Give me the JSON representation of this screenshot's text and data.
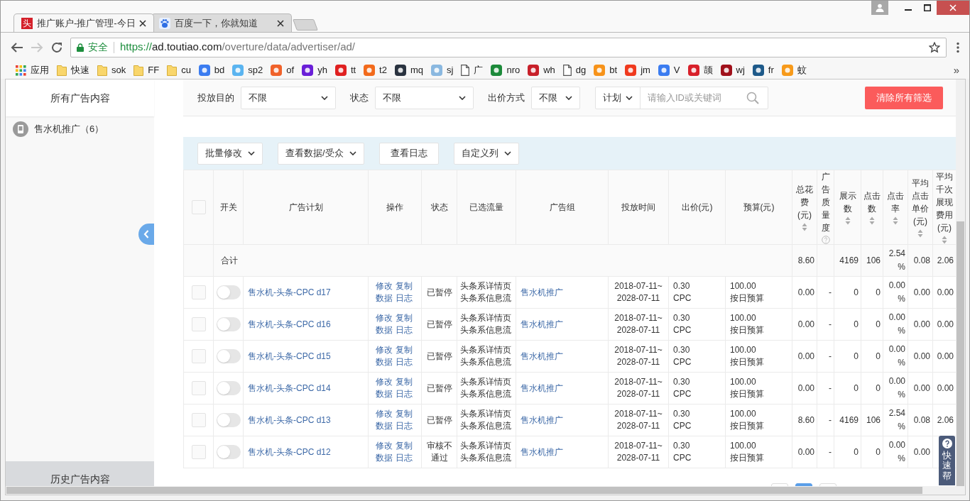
{
  "browser": {
    "tabs": [
      {
        "title": "推广账户-推广管理-今日",
        "selected": true,
        "favicon": {
          "kind": "letter",
          "text": "头"
        }
      },
      {
        "title": "百度一下，你就知道",
        "selected": false,
        "favicon": {
          "kind": "paw"
        }
      }
    ],
    "address": {
      "security": "安全",
      "scheme": "https://",
      "host": "ad.toutiao.com",
      "path": "/overture/data/advertiser/ad/"
    },
    "forward_disabled": true,
    "bookmarks": [
      {
        "label": "应用",
        "kind": "apps"
      },
      {
        "label": "快速",
        "kind": "folder"
      },
      {
        "label": "sok",
        "kind": "folder"
      },
      {
        "label": "FF",
        "kind": "folder"
      },
      {
        "label": "cu",
        "kind": "folder"
      },
      {
        "label": "bd",
        "kind": "site",
        "color": "#3b7cf0"
      },
      {
        "label": "sp2",
        "kind": "site",
        "color": "#5ab4f0"
      },
      {
        "label": "of",
        "kind": "site",
        "color": "#f0622a"
      },
      {
        "label": "yh",
        "kind": "site",
        "color": "#6a1fd8"
      },
      {
        "label": "tt",
        "kind": "site",
        "color": "#e02020"
      },
      {
        "label": "t2",
        "kind": "site",
        "color": "#f26a1b"
      },
      {
        "label": "mq",
        "kind": "site",
        "color": "#2a3340"
      },
      {
        "label": "sj",
        "kind": "site",
        "color": "#8ab8e0"
      },
      {
        "label": "广",
        "kind": "page"
      },
      {
        "label": "nro",
        "kind": "site",
        "color": "#1c8a3a"
      },
      {
        "label": "wh",
        "kind": "site",
        "color": "#c8202a"
      },
      {
        "label": "dg",
        "kind": "page"
      },
      {
        "label": "bt",
        "kind": "site",
        "color": "#f7931a"
      },
      {
        "label": "jm",
        "kind": "site",
        "color": "#f03a1e"
      },
      {
        "label": "V",
        "kind": "site",
        "color": "#3b7cf0"
      },
      {
        "label": "颉",
        "kind": "site",
        "color": "#d8202a"
      },
      {
        "label": "wj",
        "kind": "site",
        "color": "#a0101a"
      },
      {
        "label": "fr",
        "kind": "site",
        "color": "#1e5a8a"
      },
      {
        "label": "蚊",
        "kind": "site",
        "color": "#f79a1a"
      }
    ],
    "bookmarks_overflow": "»"
  },
  "sidebar": {
    "title": "所有广告内容",
    "items": [
      {
        "label": "售水机推广（6）",
        "selected": false
      }
    ],
    "history": "历史广告内容"
  },
  "filters": [
    {
      "label": "投放目的",
      "value": "不限"
    },
    {
      "label": "状态",
      "value": "不限"
    },
    {
      "label": "出价方式",
      "value": "不限"
    }
  ],
  "search": {
    "scope": "计划",
    "placeholder": "请输入ID或关键词"
  },
  "clear_button": "清除所有筛选",
  "actions": [
    {
      "label": "批量修改",
      "dropdown": true
    },
    {
      "label": "查看数据/受众",
      "dropdown": true
    },
    {
      "label": "查看日志",
      "dropdown": false
    },
    {
      "label": "自定义列",
      "dropdown": true
    }
  ],
  "table": {
    "header_checkbox": {
      "checked": false
    },
    "columns": [
      {
        "label": "开关",
        "sortable": false,
        "help": false
      },
      {
        "label": "广告计划",
        "sortable": false,
        "help": false
      },
      {
        "label": "操作",
        "sortable": false,
        "help": false
      },
      {
        "label": "状态",
        "sortable": false,
        "help": false
      },
      {
        "label": "已选流量",
        "sortable": false,
        "help": false
      },
      {
        "label": "广告组",
        "sortable": false,
        "help": false
      },
      {
        "label": "投放时间",
        "sortable": false,
        "help": false
      },
      {
        "label": "出价(元)",
        "sortable": false,
        "help": false
      },
      {
        "label": "预算(元)",
        "sortable": false,
        "help": false
      },
      {
        "label": "总花费(元)",
        "sortable": true,
        "help": false
      },
      {
        "label": "广告质量度",
        "sortable": false,
        "help": true
      },
      {
        "label": "展示数",
        "sortable": true,
        "help": false
      },
      {
        "label": "点击数",
        "sortable": true,
        "help": false
      },
      {
        "label": "点击率",
        "sortable": true,
        "help": false
      },
      {
        "label": "平均点击单价(元)",
        "sortable": true,
        "help": false
      },
      {
        "label": "平均千次展现费用(元)",
        "sortable": true,
        "help": false
      }
    ],
    "total": {
      "label": "合计",
      "metrics": {
        "cost": "8.60",
        "impressions": "4169",
        "clicks": "106",
        "ctr": "2.54 %",
        "cpc": "0.08",
        "cpm": "2.06"
      }
    },
    "rows": [
      {
        "checked": false,
        "on": false,
        "plan": "售水机-头条-CPC d17",
        "actions": [
          "修改",
          "复制",
          "数据",
          "日志"
        ],
        "status": "已暂停",
        "traffic": [
          "头条系详情页",
          "头条系信息流"
        ],
        "group": "售水机推广",
        "period": [
          "2018-07-11~",
          "2028-07-11"
        ],
        "bid": [
          "0.30",
          "CPC"
        ],
        "budget": [
          "100.00",
          "按日预算"
        ],
        "metrics": [
          "0.00",
          "-",
          "0",
          "0",
          "0.00 %",
          "0.00",
          "0.00"
        ]
      },
      {
        "checked": false,
        "on": false,
        "plan": "售水机-头条-CPC d16",
        "actions": [
          "修改",
          "复制",
          "数据",
          "日志"
        ],
        "status": "已暂停",
        "traffic": [
          "头条系详情页",
          "头条系信息流"
        ],
        "group": "售水机推广",
        "period": [
          "2018-07-11~",
          "2028-07-11"
        ],
        "bid": [
          "0.30",
          "CPC"
        ],
        "budget": [
          "100.00",
          "按日预算"
        ],
        "metrics": [
          "0.00",
          "-",
          "0",
          "0",
          "0.00 %",
          "0.00",
          "0.00"
        ]
      },
      {
        "checked": false,
        "on": false,
        "plan": "售水机-头条-CPC d15",
        "actions": [
          "修改",
          "复制",
          "数据",
          "日志"
        ],
        "status": "已暂停",
        "traffic": [
          "头条系详情页",
          "头条系信息流"
        ],
        "group": "售水机推广",
        "period": [
          "2018-07-11~",
          "2028-07-11"
        ],
        "bid": [
          "0.30",
          "CPC"
        ],
        "budget": [
          "100.00",
          "按日预算"
        ],
        "metrics": [
          "0.00",
          "-",
          "0",
          "0",
          "0.00 %",
          "0.00",
          "0.00"
        ]
      },
      {
        "checked": false,
        "on": false,
        "plan": "售水机-头条-CPC d14",
        "actions": [
          "修改",
          "复制",
          "数据",
          "日志"
        ],
        "status": "已暂停",
        "traffic": [
          "头条系详情页",
          "头条系信息流"
        ],
        "group": "售水机推广",
        "period": [
          "2018-07-11~",
          "2028-07-11"
        ],
        "bid": [
          "0.30",
          "CPC"
        ],
        "budget": [
          "100.00",
          "按日预算"
        ],
        "metrics": [
          "0.00",
          "-",
          "0",
          "0",
          "0.00 %",
          "0.00",
          "0.00"
        ]
      },
      {
        "checked": false,
        "on": false,
        "plan": "售水机-头条-CPC d13",
        "actions": [
          "修改",
          "复制",
          "数据",
          "日志"
        ],
        "status": "已暂停",
        "traffic": [
          "头条系详情页",
          "头条系信息流"
        ],
        "group": "售水机推广",
        "period": [
          "2018-07-11~",
          "2028-07-11"
        ],
        "bid": [
          "0.30",
          "CPC"
        ],
        "budget": [
          "100.00",
          "按日预算"
        ],
        "metrics": [
          "8.60",
          "-",
          "4169",
          "106",
          "2.54 %",
          "0.08",
          "2.06"
        ]
      },
      {
        "checked": false,
        "on": false,
        "plan": "售水机-头条-CPC d12",
        "actions": [
          "修改",
          "复制",
          "数据",
          "日志"
        ],
        "status": "审核不通过",
        "traffic": [
          "头条系详情页",
          "头条系信息流"
        ],
        "group": "售水机推广",
        "period": [
          "2018-07-11~",
          "2028-07-11"
        ],
        "bid": [
          "0.30",
          "CPC"
        ],
        "budget": [
          "100.00",
          "按日预算"
        ],
        "metrics": {
          "cost": "0.00",
          "quality": "-",
          "impressions": "0",
          "clicks": "0",
          "ctr": "0.00 %",
          "cpc": "0.00"
        }
      }
    ]
  },
  "pagination": [
    {
      "selected": false
    },
    {
      "selected": true
    },
    {
      "selected": false
    }
  ],
  "help_button": "快速帮"
}
